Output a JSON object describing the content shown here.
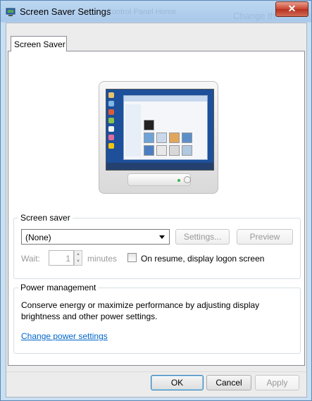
{
  "window": {
    "title": "Screen Saver Settings",
    "background_title_1": "Control Panel Home",
    "background_title_2": "Change th",
    "close_symbol": "✕"
  },
  "tab": {
    "label": "Screen Saver"
  },
  "screen_saver_group": {
    "label": "Screen saver",
    "selected": "(None)",
    "settings_label": "Settings...",
    "preview_label": "Preview",
    "wait_label": "Wait:",
    "wait_value": "1",
    "minutes_label": "minutes",
    "logon_checkbox_label": "On resume, display logon screen",
    "logon_checked": false
  },
  "power_group": {
    "label": "Power management",
    "description": "Conserve energy or maximize performance by adjusting display brightness and other power settings.",
    "link_label": "Change power settings"
  },
  "buttons": {
    "ok": "OK",
    "cancel": "Cancel",
    "apply": "Apply"
  },
  "colors": {
    "link": "#0066cc",
    "close": "#c9452f",
    "frame": "#c9dff2"
  }
}
